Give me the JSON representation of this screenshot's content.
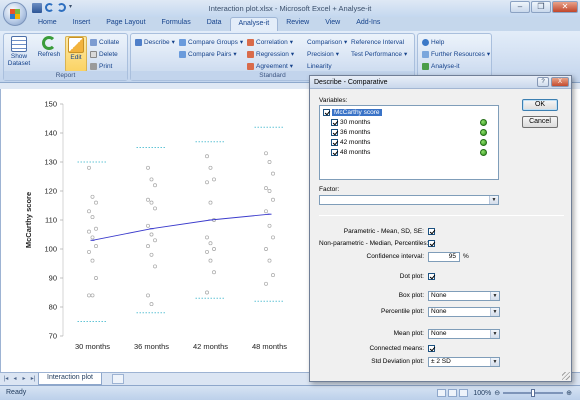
{
  "window": {
    "title": "Interaction plot.xlsx - Microsoft Excel + Analyse-it"
  },
  "ribbon_tabs": [
    "Home",
    "Insert",
    "Page Layout",
    "Formulas",
    "Data",
    "Analyse-it",
    "Review",
    "View",
    "Add-Ins"
  ],
  "active_tab": "Analyse-it",
  "ribbon": {
    "report_group": {
      "label": "Report",
      "show_dataset": "Show Dataset",
      "refresh": "Refresh",
      "edit": "Edit",
      "collate": "Collate",
      "delete": "Delete",
      "print": "Print"
    },
    "standard_group": {
      "label": "Standard",
      "describe": "Describe",
      "compare_groups": "Compare Groups",
      "compare_pairs": "Compare Pairs",
      "correlation": "Correlation",
      "regression": "Regression",
      "agreement": "Agreement",
      "comparison": "Comparison",
      "precision": "Precision",
      "linearity": "Linearity",
      "reference_interval": "Reference Interval",
      "test_performance": "Test Performance"
    },
    "help_group": {
      "help": "Help",
      "further_resources": "Further Resources",
      "analyse_it": "Analyse-it"
    }
  },
  "sheet": {
    "tab_name": "Interaction plot"
  },
  "status": {
    "text": "Ready",
    "zoom": "100%"
  },
  "chart_data": {
    "type": "scatter",
    "ylabel": "McCarthy score",
    "ylim": [
      70,
      150
    ],
    "yticks": [
      "70",
      "80",
      "90",
      "100",
      "110",
      "120",
      "130",
      "140",
      "150"
    ],
    "categories": [
      "30 months",
      "36 months",
      "42 months",
      "48 months"
    ],
    "points": [
      [
        128,
        118,
        116,
        113,
        111,
        107,
        106,
        104,
        101,
        99,
        96,
        90,
        84,
        84
      ],
      [
        128,
        124,
        122,
        117,
        116,
        114,
        108,
        105,
        103,
        101,
        98,
        94,
        84,
        81
      ],
      [
        132,
        128,
        124,
        123,
        116,
        110,
        104,
        102,
        100,
        99,
        96,
        92,
        85
      ],
      [
        133,
        130,
        126,
        121,
        120,
        117,
        113,
        108,
        104,
        100,
        96,
        91,
        88
      ]
    ],
    "means": [
      103,
      107,
      110,
      112
    ],
    "sd_upper": [
      130,
      135,
      137,
      142
    ],
    "sd_lower": [
      75,
      78,
      83,
      82
    ],
    "colors": {
      "points": "#a8a8a8",
      "means_line": "#3b3bcc",
      "sd_marks": "#62c4d6"
    }
  },
  "dialog": {
    "title": "Describe - Comparative",
    "help_glyph": "?",
    "close_glyph": "X",
    "variables_label": "Variables:",
    "variables": [
      {
        "name": "McCarthy score",
        "checked": true,
        "selected": true
      },
      {
        "name": "30 months",
        "checked": true
      },
      {
        "name": "36 months",
        "checked": true
      },
      {
        "name": "42 months",
        "checked": true
      },
      {
        "name": "48 months",
        "checked": true
      }
    ],
    "factor_label": "Factor:",
    "factor_value": "",
    "ok": "OK",
    "cancel": "Cancel",
    "parametric_label": "Parametric - Mean, SD, SE:",
    "parametric_checked": true,
    "nonparametric_label": "Non-parametric - Median, Percentiles:",
    "nonparametric_checked": true,
    "confidence_label": "Confidence interval:",
    "confidence_value": "95",
    "confidence_unit": "%",
    "dot_plot_label": "Dot plot:",
    "dot_plot_checked": true,
    "box_plot_label": "Box plot:",
    "box_plot_value": "None",
    "percentile_plot_label": "Percentile plot:",
    "percentile_plot_value": "None",
    "mean_plot_label": "Mean plot:",
    "mean_plot_value": "None",
    "connected_means_label": "Connected means:",
    "connected_means_checked": true,
    "sd_plot_label": "Std Deviation plot:",
    "sd_plot_value": "± 2 SD"
  }
}
